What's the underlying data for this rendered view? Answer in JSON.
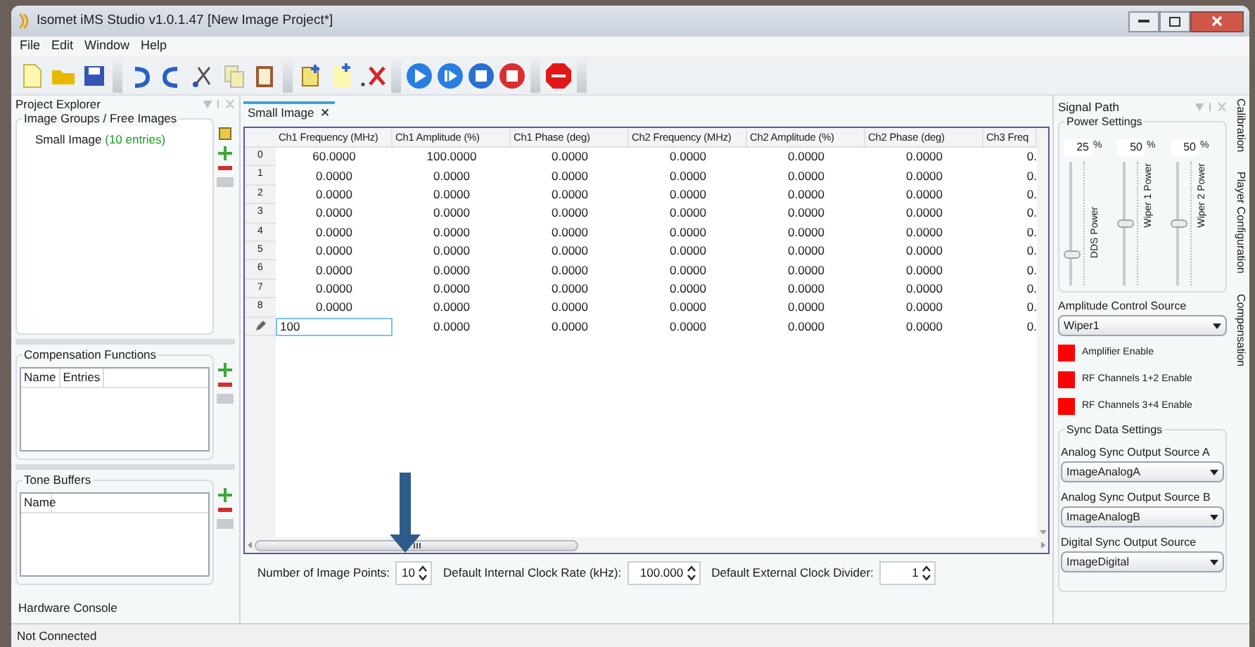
{
  "window": {
    "title": "Isomet iMS Studio v1.0.1.47 [New Image Project*]"
  },
  "menu": [
    "File",
    "Edit",
    "Window",
    "Help"
  ],
  "project_explorer": {
    "title": "Project Explorer",
    "image_groups": {
      "title": "Image Groups / Free Images",
      "items": [
        {
          "name": "Small Image",
          "count": "(10 entries)"
        }
      ]
    },
    "compensation_functions": {
      "title": "Compensation Functions",
      "columns": [
        "Name",
        "Entries"
      ]
    },
    "tone_buffers": {
      "title": "Tone Buffers",
      "columns": [
        "Name"
      ]
    }
  },
  "document_tabs": [
    {
      "label": "Small Image",
      "selected": true,
      "close": "✕"
    }
  ],
  "table": {
    "columns": [
      "Ch1 Frequency (MHz)",
      "Ch1 Amplitude (%)",
      "Ch1 Phase (deg)",
      "Ch2 Frequency (MHz)",
      "Ch2 Amplitude (%)",
      "Ch2 Phase (deg)",
      "Ch3 Freq"
    ],
    "rows": [
      {
        "header": "0",
        "cells": [
          "60.0000",
          "100.0000",
          "0.0000",
          "0.0000",
          "0.0000",
          "0.0000",
          "0."
        ]
      },
      {
        "header": "1",
        "cells": [
          "0.0000",
          "0.0000",
          "0.0000",
          "0.0000",
          "0.0000",
          "0.0000",
          "0."
        ]
      },
      {
        "header": "2",
        "cells": [
          "0.0000",
          "0.0000",
          "0.0000",
          "0.0000",
          "0.0000",
          "0.0000",
          "0."
        ]
      },
      {
        "header": "3",
        "cells": [
          "0.0000",
          "0.0000",
          "0.0000",
          "0.0000",
          "0.0000",
          "0.0000",
          "0."
        ]
      },
      {
        "header": "4",
        "cells": [
          "0.0000",
          "0.0000",
          "0.0000",
          "0.0000",
          "0.0000",
          "0.0000",
          "0."
        ]
      },
      {
        "header": "5",
        "cells": [
          "0.0000",
          "0.0000",
          "0.0000",
          "0.0000",
          "0.0000",
          "0.0000",
          "0."
        ]
      },
      {
        "header": "6",
        "cells": [
          "0.0000",
          "0.0000",
          "0.0000",
          "0.0000",
          "0.0000",
          "0.0000",
          "0."
        ]
      },
      {
        "header": "7",
        "cells": [
          "0.0000",
          "0.0000",
          "0.0000",
          "0.0000",
          "0.0000",
          "0.0000",
          "0."
        ]
      },
      {
        "header": "8",
        "cells": [
          "0.0000",
          "0.0000",
          "0.0000",
          "0.0000",
          "0.0000",
          "0.0000",
          "0."
        ]
      },
      {
        "editing": true,
        "cells": [
          "100",
          "0.0000",
          "0.0000",
          "0.0000",
          "0.0000",
          "0.0000",
          "0."
        ]
      }
    ]
  },
  "image_settings": [
    {
      "label": "Number of Image Points:",
      "value": "10"
    },
    {
      "label": "Default Internal Clock Rate (kHz):",
      "value": "100.000"
    },
    {
      "label": "Default External Clock Divider:",
      "value": "1"
    }
  ],
  "bottom_tab": "Hardware Console",
  "status_bar": "Not Connected",
  "signal_path": {
    "title": "Signal Path",
    "power_settings": {
      "title": "Power Settings",
      "sliders": [
        {
          "name": "DDS Power",
          "value": "25",
          "unit": "%",
          "level": 0.25
        },
        {
          "name": "Wiper 1 Power",
          "value": "50",
          "unit": "%",
          "level": 0.5
        },
        {
          "name": "Wiper 2 Power",
          "value": "50",
          "unit": "%",
          "level": 0.5
        }
      ]
    },
    "amplitude_control_source": {
      "label": "Amplitude Control Source",
      "value": "Wiper1"
    },
    "enables": [
      {
        "label": "Amplifier Enable",
        "on": false
      },
      {
        "label": "RF Channels 1+2 Enable",
        "on": false
      },
      {
        "label": "RF Channels 3+4 Enable",
        "on": false
      }
    ],
    "sync": {
      "title": "Sync Data Settings",
      "fields": [
        {
          "label": "Analog Sync Output Source A",
          "value": "ImageAnalogA"
        },
        {
          "label": "Analog Sync Output Source B",
          "value": "ImageAnalogB"
        },
        {
          "label": "Digital Sync Output Source",
          "value": "ImageDigital"
        }
      ]
    }
  },
  "side_tabs": [
    "Calibration",
    "Player Configuration",
    "Compensation"
  ]
}
